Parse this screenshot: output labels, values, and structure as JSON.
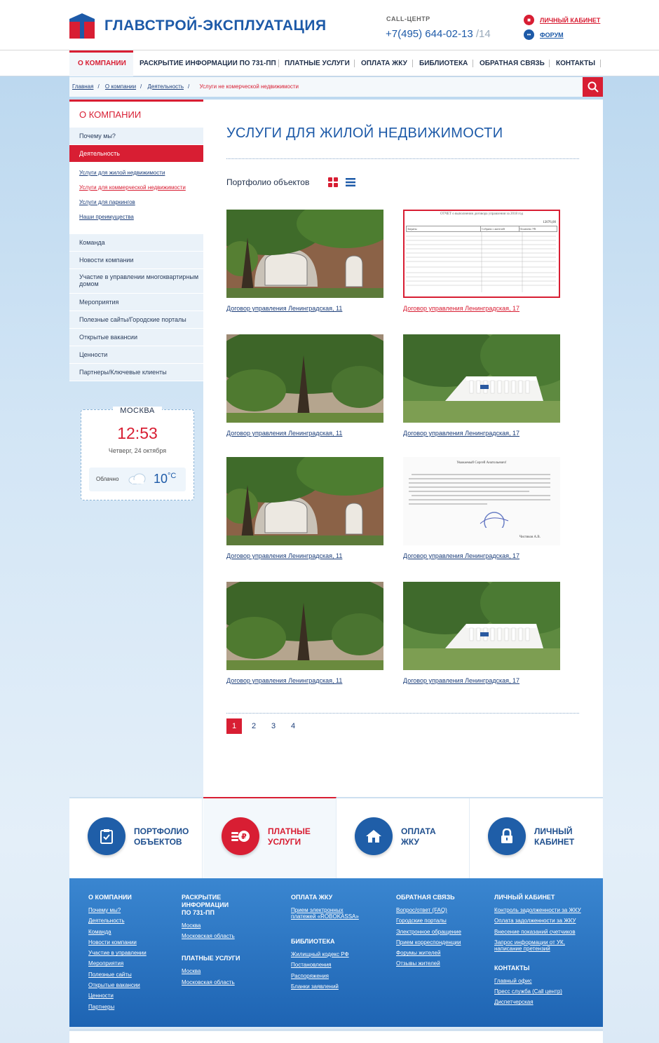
{
  "header": {
    "brand": "ГЛАВСТРОЙ-ЭКСПЛУАТАЦИЯ",
    "callcenter_label": "CALL-ЦЕНТР",
    "phone": "+7(495) 644-02-13",
    "phone_ext": " /14",
    "cabinet_link": "ЛИЧНЫЙ КАБИНЕТ",
    "forum_link": "ФОРУМ"
  },
  "nav": [
    "О КОМПАНИИ",
    "РАСКРЫТИЕ ИНФОРМАЦИИ ПО 731-ПП",
    "ПЛАТНЫЕ УСЛУГИ",
    "ОПЛАТА ЖКУ",
    "БИБЛИОТЕКА",
    "ОБРАТНАЯ СВЯЗЬ",
    "КОНТАКТЫ"
  ],
  "breadcrumbs": {
    "items": [
      "Главная",
      "О компании",
      "Деятельность"
    ],
    "current": "Услуги не комерческой недвижимости"
  },
  "sidebar": {
    "title": "О КОМПАНИИ",
    "top": [
      "Почему мы?",
      "Деятельность"
    ],
    "sub": [
      "Услуги для жилой недвижимости",
      "Услуги для коммерческой недвижимости",
      "Услуги для паркингов",
      "Наши преимущества"
    ],
    "bottom": [
      "Команда",
      "Новости компании",
      "Участие в управлении многоквартирным домом",
      "Мероприятия",
      "Полезные сайты/Городские порталы",
      "Открытые вакансии",
      "Ценности",
      "Партнеры/Ключевые клиенты"
    ]
  },
  "widget": {
    "city": "МОСКВА",
    "time": "12:53",
    "date": "Четверг, 24 октября",
    "condition": "Облачно",
    "temp": "10",
    "unit": "°C"
  },
  "main": {
    "title": "УСЛУГИ ДЛЯ ЖИЛОЙ НЕДВИЖИМОСТИ",
    "portfolio_label": "Портфолио объектов",
    "doc_report": {
      "heading": "ОТЧЕТ о выполнении договора управления за 2018 год",
      "sum": "12076,00",
      "col1": "Затраты",
      "col2": "Собрано с жителей",
      "col3": "Оплачено УК"
    },
    "doc_letter": {
      "greeting": "Уважаемый Сергей Анатольевич!",
      "signer": "Чистяков А.В."
    },
    "cards": [
      {
        "caption": "Договор управления Ленинградская, 11"
      },
      {
        "caption": "Договор управления Ленинградская, 17"
      },
      {
        "caption": "Договор управления Ленинградская, 11"
      },
      {
        "caption": "Договор управления Ленинградская, 17"
      },
      {
        "caption": "Договор управления Ленинградская, 11"
      },
      {
        "caption": "Договор управления Ленинградская, 17"
      },
      {
        "caption": "Договор управления Ленинградская, 11"
      },
      {
        "caption": "Договор управления Ленинградская, 17"
      }
    ],
    "pages": [
      "1",
      "2",
      "3",
      "4"
    ]
  },
  "tiles": [
    {
      "l1": "ПОРТФОЛИО",
      "l2": "ОБЪЕКТОВ"
    },
    {
      "l1": "ПЛАТНЫЕ",
      "l2": "УСЛУГИ"
    },
    {
      "l1": "ОПЛАТА",
      "l2": "ЖКУ"
    },
    {
      "l1": "ЛИЧНЫЙ",
      "l2": "КАБИНЕТ"
    }
  ],
  "footer": {
    "c1_h": "О КОМПАНИИ",
    "c1": [
      "Почему мы?",
      "Деятельность",
      "Команда",
      "Новости компании",
      "Участие в управлении",
      "Мероприятия",
      "Полезные сайты",
      "Открытые вакансии",
      "Ценности",
      "Партнеры"
    ],
    "c2_h": "РАСКРЫТИЕ ИНФОРМАЦИИ ПО 731-ПП",
    "c2": [
      "Москва",
      "Московская область"
    ],
    "c2b_h": "ПЛАТНЫЕ УСЛУГИ",
    "c2b": [
      "Москва",
      "Московская область"
    ],
    "c3_h": "ОПЛАТА ЖКУ",
    "c3": [
      "Прием электронных платежей «ROBOKASSA»"
    ],
    "c3b_h": "БИБЛИОТЕКА",
    "c3b": [
      "Жилищный кодекс РФ",
      "Постановления",
      "Распоряжения",
      "Бланки заявлений"
    ],
    "c4_h": "ОБРАТНАЯ СВЯЗЬ",
    "c4": [
      "Вопрос/ответ (FAQ)",
      "Городские порталы",
      "Электронное обращение",
      "Прием корреспонденции",
      "Форумы жителей",
      "Отзывы жителей"
    ],
    "c5_h": "ЛИЧНЫЙ КАБИНЕТ",
    "c5": [
      "Контроль задолженности за ЖКУ",
      "Оплата задолженности за ЖКУ",
      "Внесение показаний счетчиков",
      "Запрос информации от УК, написание претензий"
    ],
    "c5b_h": "КОНТАКТЫ",
    "c5b": [
      "Главный офис",
      "Пресс служба (Call центр)",
      "Диспетчерская"
    ]
  },
  "colors": {
    "accent": "#d81e33",
    "brand": "#1d5aa8",
    "footer": "#2a74c2"
  }
}
